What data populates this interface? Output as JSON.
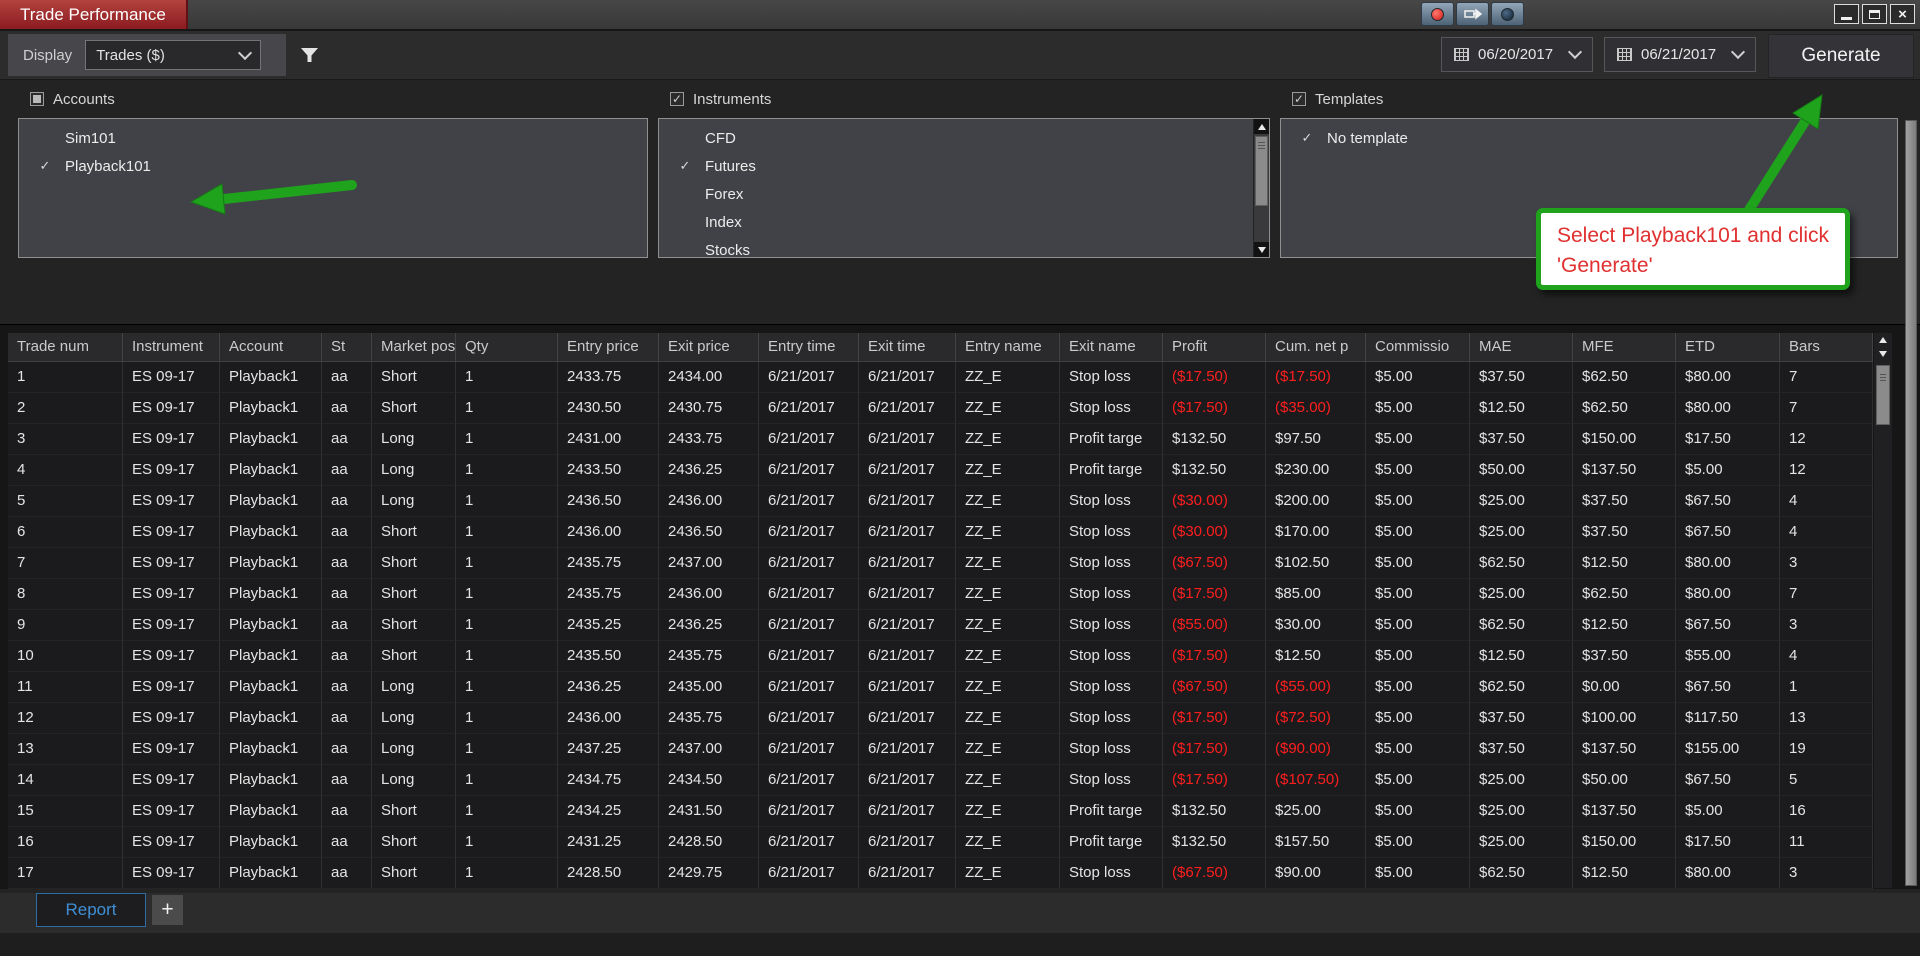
{
  "window": {
    "title": "Trade Performance",
    "controls": {
      "minimize": "–",
      "maximize": "",
      "close": "×"
    }
  },
  "toolbar": {
    "display_label": "Display",
    "display_value": "Trades ($)",
    "date_from": "06/20/2017",
    "date_to": "06/21/2017",
    "generate_label": "Generate"
  },
  "filters": {
    "accounts": {
      "label": "Accounts",
      "checkbox": "indeterminate",
      "items": [
        {
          "label": "Sim101",
          "checked": false
        },
        {
          "label": "Playback101",
          "checked": true
        }
      ]
    },
    "instruments": {
      "label": "Instruments",
      "checkbox": "checked",
      "items": [
        {
          "label": "CFD",
          "checked": false
        },
        {
          "label": "Futures",
          "checked": true
        },
        {
          "label": "Forex",
          "checked": false
        },
        {
          "label": "Index",
          "checked": false
        },
        {
          "label": "Stocks",
          "checked": false
        }
      ]
    },
    "templates": {
      "label": "Templates",
      "checkbox": "checked",
      "items": [
        {
          "label": "No template",
          "checked": true
        }
      ]
    }
  },
  "annotations": {
    "callout_text": "Select Playback101 and click 'Generate'",
    "arrow_color": "#1fa31c"
  },
  "table": {
    "columns": [
      "Trade num",
      "Instrument",
      "Account",
      "St",
      "Market pos",
      "Qty",
      "Entry price",
      "Exit price",
      "Entry time",
      "Exit time",
      "Entry name",
      "Exit name",
      "Profit",
      "Cum. net p",
      "Commissio",
      "MAE",
      "MFE",
      "ETD",
      "Bars"
    ],
    "rows": [
      [
        "1",
        "ES 09-17",
        "Playback1",
        "aa",
        "Short",
        "1",
        "2433.75",
        "2434.00",
        "6/21/2017",
        "6/21/2017",
        "ZZ_E",
        "Stop loss",
        "($17.50)",
        "($17.50)",
        "$5.00",
        "$37.50",
        "$62.50",
        "$80.00",
        "7"
      ],
      [
        "2",
        "ES 09-17",
        "Playback1",
        "aa",
        "Short",
        "1",
        "2430.50",
        "2430.75",
        "6/21/2017",
        "6/21/2017",
        "ZZ_E",
        "Stop loss",
        "($17.50)",
        "($35.00)",
        "$5.00",
        "$12.50",
        "$62.50",
        "$80.00",
        "7"
      ],
      [
        "3",
        "ES 09-17",
        "Playback1",
        "aa",
        "Long",
        "1",
        "2431.00",
        "2433.75",
        "6/21/2017",
        "6/21/2017",
        "ZZ_E",
        "Profit targe",
        "$132.50",
        "$97.50",
        "$5.00",
        "$37.50",
        "$150.00",
        "$17.50",
        "12"
      ],
      [
        "4",
        "ES 09-17",
        "Playback1",
        "aa",
        "Long",
        "1",
        "2433.50",
        "2436.25",
        "6/21/2017",
        "6/21/2017",
        "ZZ_E",
        "Profit targe",
        "$132.50",
        "$230.00",
        "$5.00",
        "$50.00",
        "$137.50",
        "$5.00",
        "12"
      ],
      [
        "5",
        "ES 09-17",
        "Playback1",
        "aa",
        "Long",
        "1",
        "2436.50",
        "2436.00",
        "6/21/2017",
        "6/21/2017",
        "ZZ_E",
        "Stop loss",
        "($30.00)",
        "$200.00",
        "$5.00",
        "$25.00",
        "$37.50",
        "$67.50",
        "4"
      ],
      [
        "6",
        "ES 09-17",
        "Playback1",
        "aa",
        "Short",
        "1",
        "2436.00",
        "2436.50",
        "6/21/2017",
        "6/21/2017",
        "ZZ_E",
        "Stop loss",
        "($30.00)",
        "$170.00",
        "$5.00",
        "$25.00",
        "$37.50",
        "$67.50",
        "4"
      ],
      [
        "7",
        "ES 09-17",
        "Playback1",
        "aa",
        "Short",
        "1",
        "2435.75",
        "2437.00",
        "6/21/2017",
        "6/21/2017",
        "ZZ_E",
        "Stop loss",
        "($67.50)",
        "$102.50",
        "$5.00",
        "$62.50",
        "$12.50",
        "$80.00",
        "3"
      ],
      [
        "8",
        "ES 09-17",
        "Playback1",
        "aa",
        "Short",
        "1",
        "2435.75",
        "2436.00",
        "6/21/2017",
        "6/21/2017",
        "ZZ_E",
        "Stop loss",
        "($17.50)",
        "$85.00",
        "$5.00",
        "$25.00",
        "$62.50",
        "$80.00",
        "7"
      ],
      [
        "9",
        "ES 09-17",
        "Playback1",
        "aa",
        "Short",
        "1",
        "2435.25",
        "2436.25",
        "6/21/2017",
        "6/21/2017",
        "ZZ_E",
        "Stop loss",
        "($55.00)",
        "$30.00",
        "$5.00",
        "$62.50",
        "$12.50",
        "$67.50",
        "3"
      ],
      [
        "10",
        "ES 09-17",
        "Playback1",
        "aa",
        "Short",
        "1",
        "2435.50",
        "2435.75",
        "6/21/2017",
        "6/21/2017",
        "ZZ_E",
        "Stop loss",
        "($17.50)",
        "$12.50",
        "$5.00",
        "$12.50",
        "$37.50",
        "$55.00",
        "4"
      ],
      [
        "11",
        "ES 09-17",
        "Playback1",
        "aa",
        "Long",
        "1",
        "2436.25",
        "2435.00",
        "6/21/2017",
        "6/21/2017",
        "ZZ_E",
        "Stop loss",
        "($67.50)",
        "($55.00)",
        "$5.00",
        "$62.50",
        "$0.00",
        "$67.50",
        "1"
      ],
      [
        "12",
        "ES 09-17",
        "Playback1",
        "aa",
        "Long",
        "1",
        "2436.00",
        "2435.75",
        "6/21/2017",
        "6/21/2017",
        "ZZ_E",
        "Stop loss",
        "($17.50)",
        "($72.50)",
        "$5.00",
        "$37.50",
        "$100.00",
        "$117.50",
        "13"
      ],
      [
        "13",
        "ES 09-17",
        "Playback1",
        "aa",
        "Long",
        "1",
        "2437.25",
        "2437.00",
        "6/21/2017",
        "6/21/2017",
        "ZZ_E",
        "Stop loss",
        "($17.50)",
        "($90.00)",
        "$5.00",
        "$37.50",
        "$137.50",
        "$155.00",
        "19"
      ],
      [
        "14",
        "ES 09-17",
        "Playback1",
        "aa",
        "Long",
        "1",
        "2434.75",
        "2434.50",
        "6/21/2017",
        "6/21/2017",
        "ZZ_E",
        "Stop loss",
        "($17.50)",
        "($107.50)",
        "$5.00",
        "$25.00",
        "$50.00",
        "$67.50",
        "5"
      ],
      [
        "15",
        "ES 09-17",
        "Playback1",
        "aa",
        "Short",
        "1",
        "2434.25",
        "2431.50",
        "6/21/2017",
        "6/21/2017",
        "ZZ_E",
        "Profit targe",
        "$132.50",
        "$25.00",
        "$5.00",
        "$25.00",
        "$137.50",
        "$5.00",
        "16"
      ],
      [
        "16",
        "ES 09-17",
        "Playback1",
        "aa",
        "Short",
        "1",
        "2431.25",
        "2428.50",
        "6/21/2017",
        "6/21/2017",
        "ZZ_E",
        "Profit targe",
        "$132.50",
        "$157.50",
        "$5.00",
        "$25.00",
        "$150.00",
        "$17.50",
        "11"
      ],
      [
        "17",
        "ES 09-17",
        "Playback1",
        "aa",
        "Short",
        "1",
        "2428.50",
        "2429.75",
        "6/21/2017",
        "6/21/2017",
        "ZZ_E",
        "Stop loss",
        "($67.50)",
        "$90.00",
        "$5.00",
        "$62.50",
        "$12.50",
        "$80.00",
        "3"
      ]
    ]
  },
  "tabs": {
    "report": "Report",
    "add": "+"
  }
}
